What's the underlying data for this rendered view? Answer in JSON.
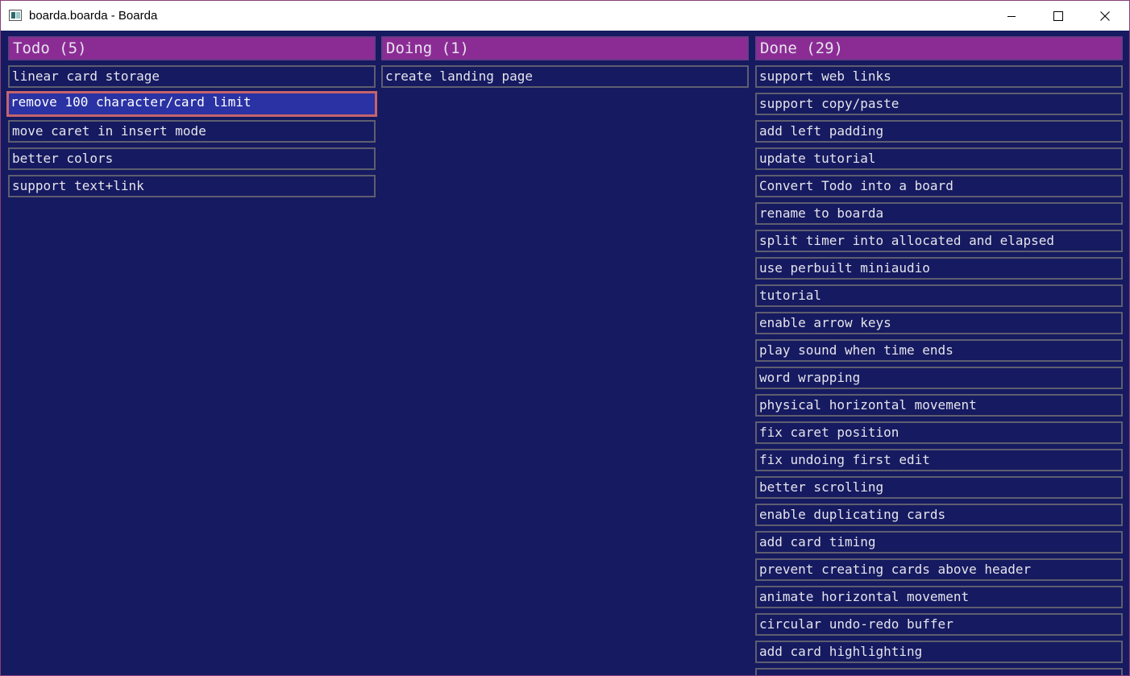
{
  "window": {
    "title": "boarda.boarda - Boarda"
  },
  "columns": [
    {
      "header": "Todo (5)",
      "cards": [
        "linear card storage",
        "remove 100 character/card limit",
        "move caret in insert mode",
        "better colors",
        "support text+link"
      ]
    },
    {
      "header": "Doing (1)",
      "cards": [
        "create landing page"
      ]
    },
    {
      "header": "Done (29)",
      "cards": [
        "support web links",
        "support copy/paste",
        "add left padding",
        "update tutorial",
        "Convert Todo into a board",
        "rename to boarda",
        "split timer into allocated and elapsed",
        "use perbuilt miniaudio",
        "tutorial",
        "enable arrow keys",
        "play sound when time ends",
        "word wrapping",
        "physical horizontal movement",
        "fix caret position",
        "fix undoing first edit",
        "better scrolling",
        "enable duplicating cards",
        "add card timing",
        "prevent creating cards above header",
        "animate horizontal movement",
        "circular undo-redo buffer",
        "add card highlighting",
        ""
      ]
    }
  ],
  "selected_card": "remove 100 character/card limit",
  "colors": {
    "background": "#161a60",
    "header": "#8b2c95",
    "card_border": "#5e5e70",
    "selected_fill": "#2a32a4",
    "selected_border": "#c5646c",
    "text": "#e4e4ec"
  }
}
